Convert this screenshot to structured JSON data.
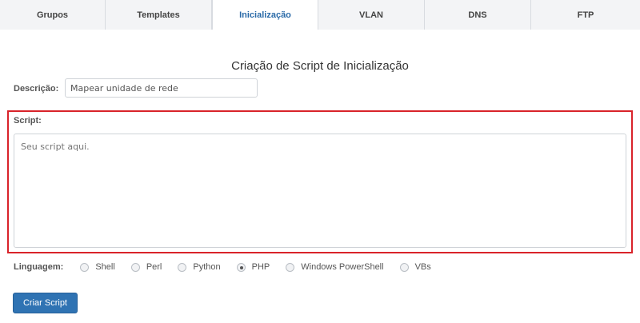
{
  "tabs": [
    {
      "label": "Grupos",
      "active": false
    },
    {
      "label": "Templates",
      "active": false
    },
    {
      "label": "Inicialização",
      "active": true
    },
    {
      "label": "VLAN",
      "active": false
    },
    {
      "label": "DNS",
      "active": false
    },
    {
      "label": "FTP",
      "active": false
    }
  ],
  "form": {
    "title": "Criação de Script de Inicialização",
    "description_label": "Descrição:",
    "description_value": "Mapear unidade de rede",
    "script_label": "Script:",
    "script_placeholder": "Seu script aqui.",
    "language_label": "Linguagem:",
    "languages": [
      "Shell",
      "Perl",
      "Python",
      "PHP",
      "Windows PowerShell",
      "VBs"
    ],
    "selected_language": "PHP",
    "submit_label": "Criar Script"
  },
  "colors": {
    "accent": "#2f73b3",
    "highlight": "#d9232a"
  }
}
